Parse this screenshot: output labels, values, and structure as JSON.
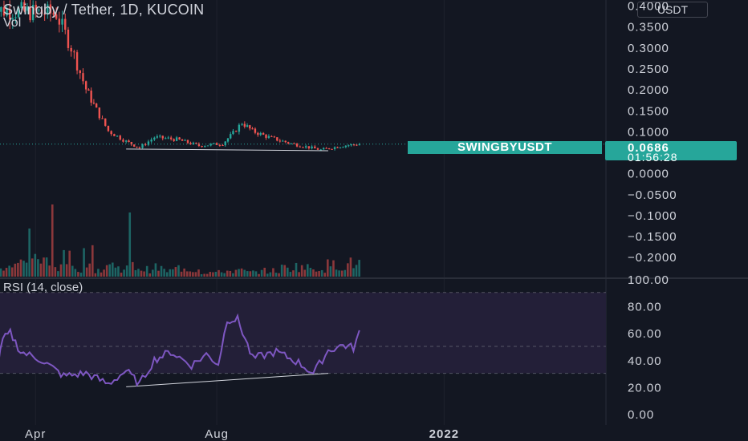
{
  "header": {
    "title": "Swingby / Tether, 1D, KUCOIN",
    "volume_label": "Vol",
    "unit_label": "USDT"
  },
  "rsi_panel": {
    "title": "RSI (14, close)"
  },
  "last_price": {
    "symbol": "SWINGBYUSDT",
    "price": "0.0686",
    "countdown": "01:56:28"
  },
  "colors": {
    "background": "#131722",
    "up": "#26a69a",
    "down": "#ef5350",
    "rsi_line": "#7e57c2",
    "rsi_band": "#231f38",
    "axis_text": "#d1d4dc",
    "grid": "#1e222d"
  },
  "chart_data": [
    {
      "type": "candlestick",
      "title": "Swingby / Tether, 1D, KUCOIN",
      "y_ticks": [
        "0.4000",
        "0.3500",
        "0.3000",
        "0.2500",
        "0.2000",
        "0.1500",
        "0.1000",
        "0.0500",
        "0.0000",
        "−0.0500",
        "−0.1000",
        "−0.1500",
        "−0.2000"
      ],
      "y_tick_values": [
        0.4,
        0.35,
        0.3,
        0.25,
        0.2,
        0.15,
        0.1,
        0.05,
        0.0,
        -0.05,
        -0.1,
        -0.15,
        -0.2
      ],
      "ylim": [
        -0.215,
        0.405
      ],
      "x_ticks": [
        "Apr",
        "Aug",
        "2022"
      ],
      "last_price": 0.0686,
      "trendline": {
        "from": [
          "2021-06-01",
          0.057
        ],
        "to": [
          "2021-10-15",
          0.053
        ]
      },
      "price_path_key_points": [
        {
          "x": "2021-03-01",
          "close": 0.39
        },
        {
          "x": "2021-04-15",
          "close": 0.38
        },
        {
          "x": "2021-04-25",
          "close": 0.3
        },
        {
          "x": "2021-05-05",
          "close": 0.2
        },
        {
          "x": "2021-05-12",
          "close": 0.15
        },
        {
          "x": "2021-05-20",
          "close": 0.1
        },
        {
          "x": "2021-06-01",
          "close": 0.075
        },
        {
          "x": "2021-06-10",
          "close": 0.06
        },
        {
          "x": "2021-06-20",
          "close": 0.085
        },
        {
          "x": "2021-07-05",
          "close": 0.08
        },
        {
          "x": "2021-07-20",
          "close": 0.065
        },
        {
          "x": "2021-08-05",
          "close": 0.07
        },
        {
          "x": "2021-08-12",
          "close": 0.095
        },
        {
          "x": "2021-08-18",
          "close": 0.12
        },
        {
          "x": "2021-08-25",
          "close": 0.1
        },
        {
          "x": "2021-09-05",
          "close": 0.085
        },
        {
          "x": "2021-09-20",
          "close": 0.07
        },
        {
          "x": "2021-10-10",
          "close": 0.055
        },
        {
          "x": "2021-10-25",
          "close": 0.065
        },
        {
          "x": "2021-11-05",
          "close": 0.0686
        }
      ]
    },
    {
      "type": "volume",
      "series": [
        {
          "name": "Vol",
          "values_relative": [
            0.3,
            0.4,
            0.45,
            0.9,
            0.5,
            0.35,
            0.6,
            0.3,
            0.7,
            0.25,
            0.4,
            0.3,
            0.35,
            0.25,
            0.3,
            0.2,
            0.3,
            0.25,
            0.15,
            0.15,
            0.2,
            0.2,
            0.15,
            0.2,
            0.2,
            0.3,
            0.35,
            0.3,
            0.3,
            0.4,
            0.4,
            0.45
          ]
        }
      ]
    },
    {
      "type": "line",
      "title": "RSI (14, close)",
      "y_ticks": [
        "100.00",
        "80.00",
        "60.00",
        "40.00",
        "20.00",
        "0.00"
      ],
      "y_tick_values": [
        100,
        80,
        60,
        40,
        20,
        0
      ],
      "ylim": [
        0,
        100
      ],
      "band": [
        30,
        70
      ],
      "x_ticks": [
        "Apr",
        "Aug",
        "2022"
      ],
      "trendline": {
        "from": [
          "2021-06-01",
          20
        ],
        "to": [
          "2021-10-15",
          30
        ]
      },
      "series": [
        {
          "values_key_points": [
            {
              "x": "2021-03-01",
              "y": 32
            },
            {
              "x": "2021-03-05",
              "y": 26
            },
            {
              "x": "2021-03-10",
              "y": 55
            },
            {
              "x": "2021-03-15",
              "y": 60
            },
            {
              "x": "2021-03-22",
              "y": 46
            },
            {
              "x": "2021-04-05",
              "y": 40
            },
            {
              "x": "2021-04-20",
              "y": 28
            },
            {
              "x": "2021-05-05",
              "y": 30
            },
            {
              "x": "2021-05-20",
              "y": 22
            },
            {
              "x": "2021-06-01",
              "y": 32
            },
            {
              "x": "2021-06-10",
              "y": 22
            },
            {
              "x": "2021-06-20",
              "y": 40
            },
            {
              "x": "2021-07-01",
              "y": 46
            },
            {
              "x": "2021-07-15",
              "y": 36
            },
            {
              "x": "2021-07-25",
              "y": 44
            },
            {
              "x": "2021-08-02",
              "y": 37
            },
            {
              "x": "2021-08-08",
              "y": 70
            },
            {
              "x": "2021-08-15",
              "y": 70
            },
            {
              "x": "2021-08-20",
              "y": 56
            },
            {
              "x": "2021-08-25",
              "y": 41
            },
            {
              "x": "2021-09-10",
              "y": 46
            },
            {
              "x": "2021-09-25",
              "y": 38
            },
            {
              "x": "2021-10-05",
              "y": 30
            },
            {
              "x": "2021-10-15",
              "y": 47
            },
            {
              "x": "2021-10-25",
              "y": 51
            },
            {
              "x": "2021-11-01",
              "y": 49
            },
            {
              "x": "2021-11-05",
              "y": 60
            }
          ]
        }
      ]
    }
  ]
}
